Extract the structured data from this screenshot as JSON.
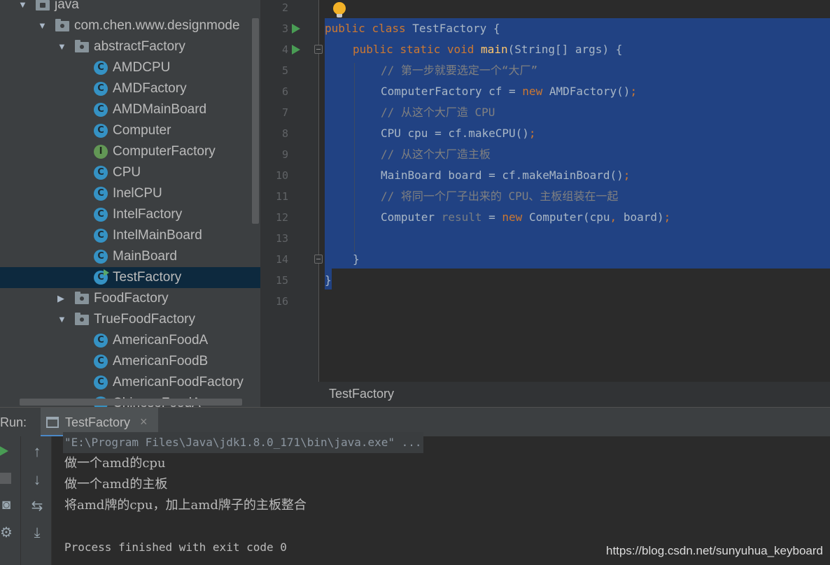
{
  "tree": {
    "items": [
      {
        "label": "java",
        "kind": "folder",
        "expanded": true
      },
      {
        "label": "com.chen.www.designmode",
        "kind": "package",
        "expanded": true
      },
      {
        "label": "abstractFactory",
        "kind": "package",
        "expanded": true
      },
      {
        "label": "AMDCPU",
        "kind": "class",
        "icon": "C"
      },
      {
        "label": "AMDFactory",
        "kind": "class",
        "icon": "C"
      },
      {
        "label": "AMDMainBoard",
        "kind": "class",
        "icon": "C"
      },
      {
        "label": "Computer",
        "kind": "class",
        "icon": "C"
      },
      {
        "label": "ComputerFactory",
        "kind": "interface",
        "icon": "I"
      },
      {
        "label": "CPU",
        "kind": "class",
        "icon": "C"
      },
      {
        "label": "InelCPU",
        "kind": "class",
        "icon": "C"
      },
      {
        "label": "IntelFactory",
        "kind": "class",
        "icon": "C"
      },
      {
        "label": "IntelMainBoard",
        "kind": "class",
        "icon": "C"
      },
      {
        "label": "MainBoard",
        "kind": "class",
        "icon": "C"
      },
      {
        "label": "TestFactory",
        "kind": "class",
        "icon": "C",
        "selected": true,
        "runnable": true
      },
      {
        "label": "FoodFactory",
        "kind": "package",
        "expanded": false
      },
      {
        "label": "TrueFoodFactory",
        "kind": "package",
        "expanded": true
      },
      {
        "label": "AmericanFoodA",
        "kind": "class",
        "icon": "C"
      },
      {
        "label": "AmericanFoodB",
        "kind": "class",
        "icon": "C"
      },
      {
        "label": "AmericanFoodFactory",
        "kind": "class",
        "icon": "C"
      },
      {
        "label": "ChineseFoodA",
        "kind": "class",
        "icon": "C"
      }
    ]
  },
  "editor": {
    "line_numbers": [
      "2",
      "3",
      "4",
      "5",
      "6",
      "7",
      "8",
      "9",
      "10",
      "11",
      "12",
      "13",
      "14",
      "15",
      "16"
    ],
    "breadcrumb": "TestFactory",
    "lines": {
      "l3": {
        "kw1": "public",
        "kw2": "class",
        "rest": "TestFactory {"
      },
      "l4": {
        "kw1": "public",
        "kw2": "static",
        "kw3": "void",
        "fn": "main",
        "rest": "(String[] args) {"
      },
      "l5": {
        "comment": "// 第一步就要选定一个“大厂”"
      },
      "l6": {
        "a": "ComputerFactory cf = ",
        "kw": "new",
        "b": " AMDFactory()",
        "semi": ";"
      },
      "l7": {
        "comment": "// 从这个大厂造 CPU"
      },
      "l8": {
        "a": "CPU cpu = cf.makeCPU()",
        "semi": ";"
      },
      "l9": {
        "comment": "// 从这个大厂造主板"
      },
      "l10": {
        "a": "MainBoard board = cf.makeMainBoard()",
        "semi": ";"
      },
      "l11": {
        "comment": "// 将同一个厂子出来的 CPU、主板组装在一起"
      },
      "l12": {
        "a": "Computer ",
        "unused": "result",
        "b": " = ",
        "kw": "new",
        "c": " Computer(cpu",
        "comma": ",",
        "d": " board)",
        "semi": ";"
      },
      "l14": {
        "a": "}"
      },
      "l15": {
        "a": "}"
      }
    }
  },
  "run": {
    "label": "Run:",
    "tab_title": "TestFactory",
    "tab_close": "×",
    "console": {
      "cmd": "\"E:\\Program Files\\Java\\jdk1.8.0_171\\bin\\java.exe\" ...",
      "out1": "做一个amd的cpu",
      "out2": "做一个amd的主板",
      "out3": "将amd牌的cpu，加上amd牌子的主板整合",
      "exit": "Process finished with exit code 0"
    },
    "tools": {
      "up": "↑",
      "down": "↓",
      "wrap": "⇆",
      "scroll_end": "⤓",
      "camera": "◙",
      "gear": "⚙"
    }
  },
  "watermark": "https://blog.csdn.net/sunyuhua_keyboard",
  "colors": {
    "selection": "#214283",
    "keyword": "#cc7832",
    "function": "#ffc66d",
    "comment": "#808080",
    "class_icon": "#3592c4",
    "interface_icon": "#629755",
    "run": "#499c54"
  }
}
